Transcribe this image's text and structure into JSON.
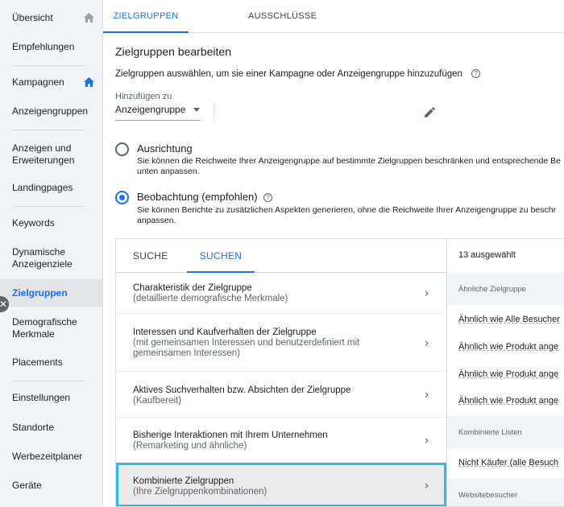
{
  "sidebar": {
    "items": [
      {
        "label": "Übersicht"
      },
      {
        "label": "Empfehlungen"
      },
      {
        "label": "Kampagnen"
      },
      {
        "label": "Anzeigengruppen"
      },
      {
        "label": "Anzeigen und Erweiterungen"
      },
      {
        "label": "Landingpages"
      },
      {
        "label": "Keywords"
      },
      {
        "label": "Dynamische Anzeigenziele"
      },
      {
        "label": "Zielgruppen"
      },
      {
        "label": "Demografische Merkmale"
      },
      {
        "label": "Placements"
      },
      {
        "label": "Einstellungen"
      },
      {
        "label": "Standorte"
      },
      {
        "label": "Werbezeitplaner"
      },
      {
        "label": "Geräte"
      }
    ],
    "active": "Zielgruppen"
  },
  "tabs": [
    {
      "label": "ZIELGRUPPEN"
    },
    {
      "label": "AUSSCHLÜSSE"
    }
  ],
  "page": {
    "title": "Zielgruppen bearbeiten",
    "subtitle": "Zielgruppen auswählen, um sie einer Kampagne oder Anzeigengruppe hinzuzufügen",
    "add_to_label": "Hinzufügen zu",
    "add_to_value": "Anzeigengruppe"
  },
  "options": [
    {
      "title": "Ausrichtung",
      "desc": "Sie können die Reichweite Ihrer Anzeigengruppe auf bestimmte Zielgruppen beschränken und entsprechende Be unten anpassen.",
      "selected": false
    },
    {
      "title": "Beobachtung (empfohlen)",
      "desc": "Sie können Berichte zu zusätzlichen Aspekten generieren, ohne die Reichweite Ihrer Anzeigengruppe zu beschr anpassen.",
      "selected": true
    }
  ],
  "panel": {
    "subtabs": [
      {
        "label": "SUCHE"
      },
      {
        "label": "SUCHEN"
      }
    ],
    "categories": [
      {
        "title": "Charakteristik der Zielgruppe",
        "sub": "(detaillierte demografische Merkmale)"
      },
      {
        "title": "Interessen und Kaufverhalten der Zielgruppe",
        "sub": "(mit gemeinsamen Interessen und benutzerdefiniert mit gemeinsamen Interessen)"
      },
      {
        "title": "Aktives Suchverhalten bzw. Absichten der Zielgruppe",
        "sub": "(Kaufbereit)"
      },
      {
        "title": "Bisherige Interaktionen mit Ihrem Unternehmen",
        "sub": "(Remarketing und ähnliche)"
      },
      {
        "title": "Kombinierte Zielgruppen",
        "sub": "(Ihre Zielgruppenkombinationen)"
      }
    ],
    "selected_count": "13 ausgewählt",
    "right_sections": [
      {
        "label": "Ähnliche Zielgruppe"
      },
      {
        "label": "Kombinierte Listen"
      },
      {
        "label": "Websitebesucher"
      }
    ],
    "right_items": [
      {
        "label": "Ähnlich wie Alle Besucher"
      },
      {
        "label": "Ähnlich wie Produkt ange"
      },
      {
        "label": "Ähnlich wie Produkt ange"
      },
      {
        "label": "Ähnlich wie Produkt ange"
      },
      {
        "label": "Nicht Käufer (alle Besuch"
      }
    ]
  },
  "colors": {
    "accent": "#1a73e8",
    "highlight_border": "#2bbbe8"
  }
}
